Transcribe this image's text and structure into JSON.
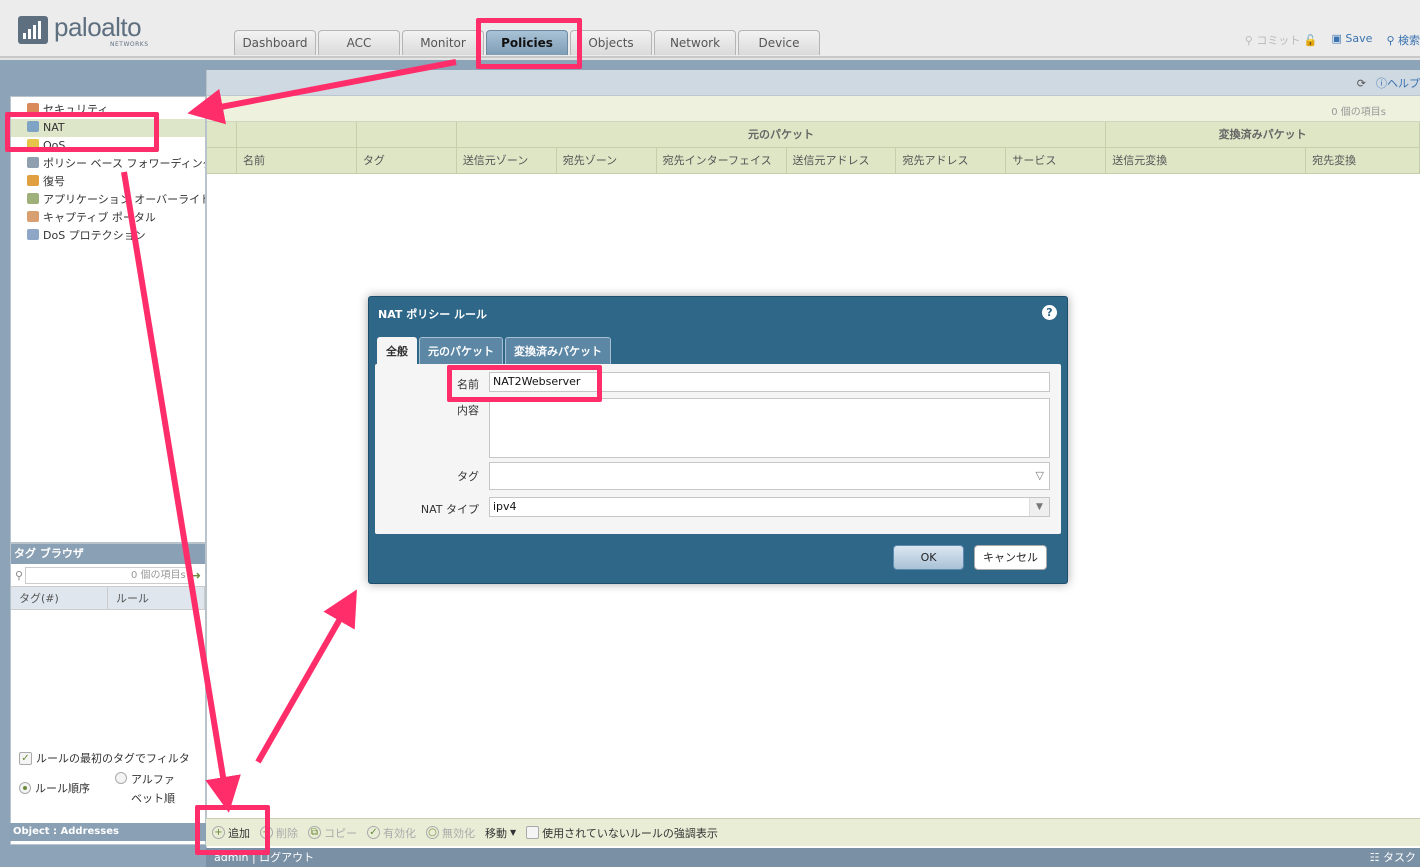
{
  "header": {
    "logo_text": "paloalto",
    "logo_sub": "NETWORKS",
    "tabs": [
      "Dashboard",
      "ACC",
      "Monitor",
      "Policies",
      "Objects",
      "Network",
      "Device"
    ],
    "active_tab": "Policies",
    "commit_label": "コミット",
    "save_label": "Save",
    "search_label": "検索"
  },
  "sidebar": {
    "items": [
      "セキュリティ",
      "NAT",
      "QoS",
      "ポリシー ベース フォワーディング",
      "復号",
      "アプリケーション オーバーライド",
      "キャプティブ ポータル",
      "DoS プロテクション"
    ],
    "selected": "NAT"
  },
  "tag_browser": {
    "title": "タグ ブラウザ",
    "count_text": "0 個の項目s",
    "col_tag": "タグ(#)",
    "col_rule": "ルール",
    "filter_first_tag": "ルールの最初のタグでフィルタ",
    "order_rule": "ルール順序",
    "order_alpha_1": "アルファ",
    "order_alpha_2": "ベット順",
    "object_bar": "Object : Addresses"
  },
  "main": {
    "help": "ヘルプ",
    "count_text": "0 個の項目s",
    "group_original": "元のパケット",
    "group_translated": "変換済みパケット",
    "columns": [
      "名前",
      "タグ",
      "送信元ゾーン",
      "宛先ゾーン",
      "宛先インターフェイス",
      "送信元アドレス",
      "宛先アドレス",
      "サービス",
      "送信元変換",
      "宛先変換"
    ]
  },
  "toolbar": {
    "add": "追加",
    "delete": "削除",
    "copy": "コピー",
    "enable": "有効化",
    "disable": "無効化",
    "move": "移動",
    "highlight_unused": "使用されていないルールの強調表示"
  },
  "status": {
    "user": "admin",
    "logout": "ログアウト",
    "tasks": "タスク"
  },
  "dialog": {
    "title": "NAT ポリシー ルール",
    "tabs": [
      "全般",
      "元のパケット",
      "変換済みパケット"
    ],
    "active_tab": "全般",
    "name_label": "名前",
    "name_value": "NAT2Webserver",
    "desc_label": "内容",
    "tag_label": "タグ",
    "nat_type_label": "NAT タイプ",
    "nat_type_value": "ipv4",
    "ok": "OK",
    "cancel": "キャンセル"
  },
  "colors": {
    "annotation": "#ff2e6a",
    "dialog_bg": "#2f6789",
    "active_tab": "#8fadc5"
  }
}
